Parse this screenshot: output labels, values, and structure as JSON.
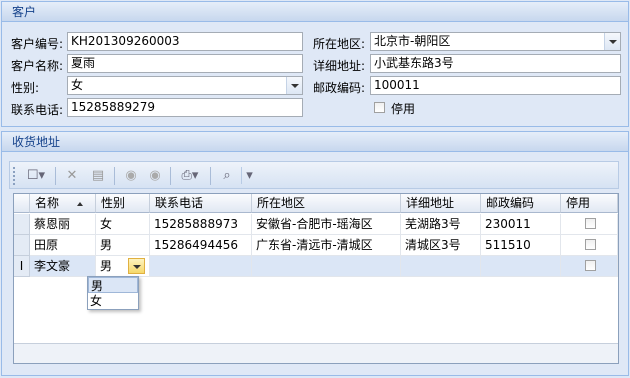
{
  "customer": {
    "title": "客户",
    "code_label": "客户编号:",
    "code_value": "KH201309260003",
    "name_label": "客户名称:",
    "name_value": "夏雨",
    "gender_label": "性别:",
    "gender_value": "女",
    "phone_label": "联系电话:",
    "phone_value": "15285889279",
    "region_label": "所在地区:",
    "region_value": "北京市-朝阳区",
    "address_label": "详细地址:",
    "address_value": "小武基东路3号",
    "postal_label": "邮政编码:",
    "postal_value": "100011",
    "disabled_label": "停用"
  },
  "shipping": {
    "title": "收货地址",
    "toolbar": [
      "new-icon",
      "delete-icon",
      "save-icon",
      "up-icon",
      "down-icon",
      "print-icon",
      "search-icon",
      "more-icon"
    ],
    "columns": [
      "名称",
      "性别",
      "联系电话",
      "所在地区",
      "详细地址",
      "邮政编码",
      "停用"
    ],
    "rows": [
      {
        "name": "蔡恩丽",
        "gender": "女",
        "phone": "15285888973",
        "region": "安徽省-合肥市-瑶海区",
        "address": "芜湖路3号",
        "postal": "230011"
      },
      {
        "name": "田原",
        "gender": "男",
        "phone": "15286494456",
        "region": "广东省-清远市-清城区",
        "address": "清城区3号",
        "postal": "511510"
      },
      {
        "name": "李文豪",
        "gender": "男",
        "phone": "",
        "region": "",
        "address": "",
        "postal": ""
      }
    ],
    "edit_indicator": "I",
    "gender_options": [
      "男",
      "女"
    ]
  }
}
